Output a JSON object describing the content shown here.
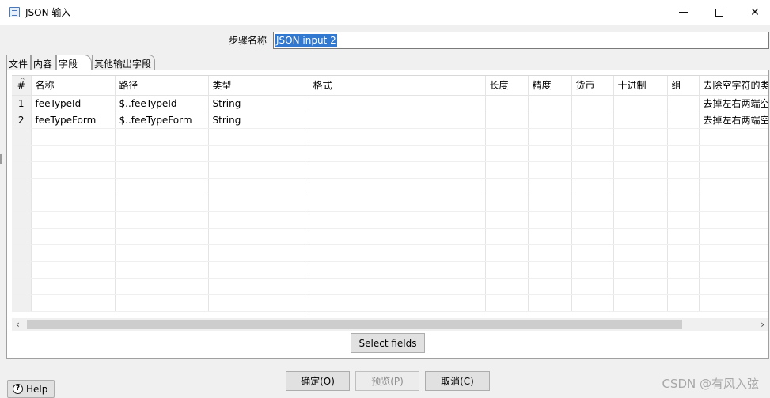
{
  "window": {
    "title": "JSON 输入"
  },
  "step": {
    "label": "步骤名称",
    "value": "JSON input 2"
  },
  "tabs": [
    {
      "label": "文件"
    },
    {
      "label": "内容"
    },
    {
      "label": "字段"
    },
    {
      "label": "其他输出字段"
    }
  ],
  "grid": {
    "columns": [
      "#",
      "名称",
      "路径",
      "类型",
      "格式",
      "长度",
      "精度",
      "货币",
      "十进制",
      "组",
      "去除空字符的类型"
    ],
    "rows": [
      [
        "1",
        "feeTypeId",
        "$..feeTypeId",
        "String",
        "",
        "",
        "",
        "",
        "",
        "",
        "去掉左右两端空格"
      ],
      [
        "2",
        "feeTypeForm",
        "$..feeTypeForm",
        "String",
        "",
        "",
        "",
        "",
        "",
        "",
        "去掉左右两端空格"
      ]
    ]
  },
  "buttons": {
    "select_fields": "Select fields",
    "ok": "确定(O)",
    "preview": "预览(P)",
    "cancel": "取消(C)",
    "help": "Help"
  },
  "watermark": "CSDN @有风入弦"
}
